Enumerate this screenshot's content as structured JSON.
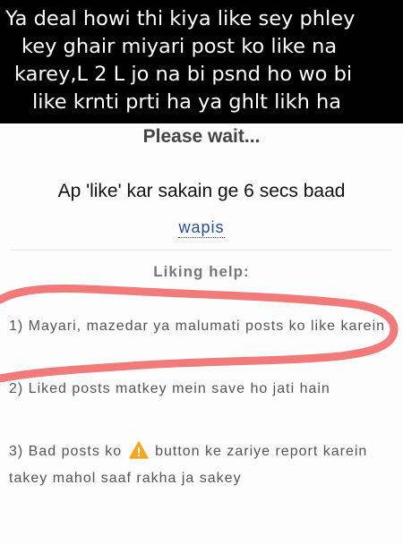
{
  "caption": {
    "line1": "Ya deal howi thi kiya like sey phley",
    "line2": "key ghair miyari post ko like na",
    "line3": "karey,L 2 L jo na bi psnd ho wo bi",
    "line4": "like krnti prti ha ya ghlt likh ha"
  },
  "page": {
    "wait_text": "Please wait...",
    "timer_text": "Ap 'like' kar sakain ge 6 secs baad",
    "back_link": "wapis"
  },
  "help": {
    "title": "Liking help:",
    "tip1": "1) Mayari, mazedar ya malumati posts ko like karein",
    "tip2": "2) Liked posts matkey mein save ho jati hain",
    "tip3_before": "3) Bad posts ko",
    "tip3_after": "button ke zariye report karein takey mahol saaf rakha ja sakey",
    "warning_icon": "warning-icon"
  },
  "colors": {
    "annotation_stroke": "#f06b6b",
    "link": "#2a4d8f",
    "warning": "#f5a623"
  }
}
